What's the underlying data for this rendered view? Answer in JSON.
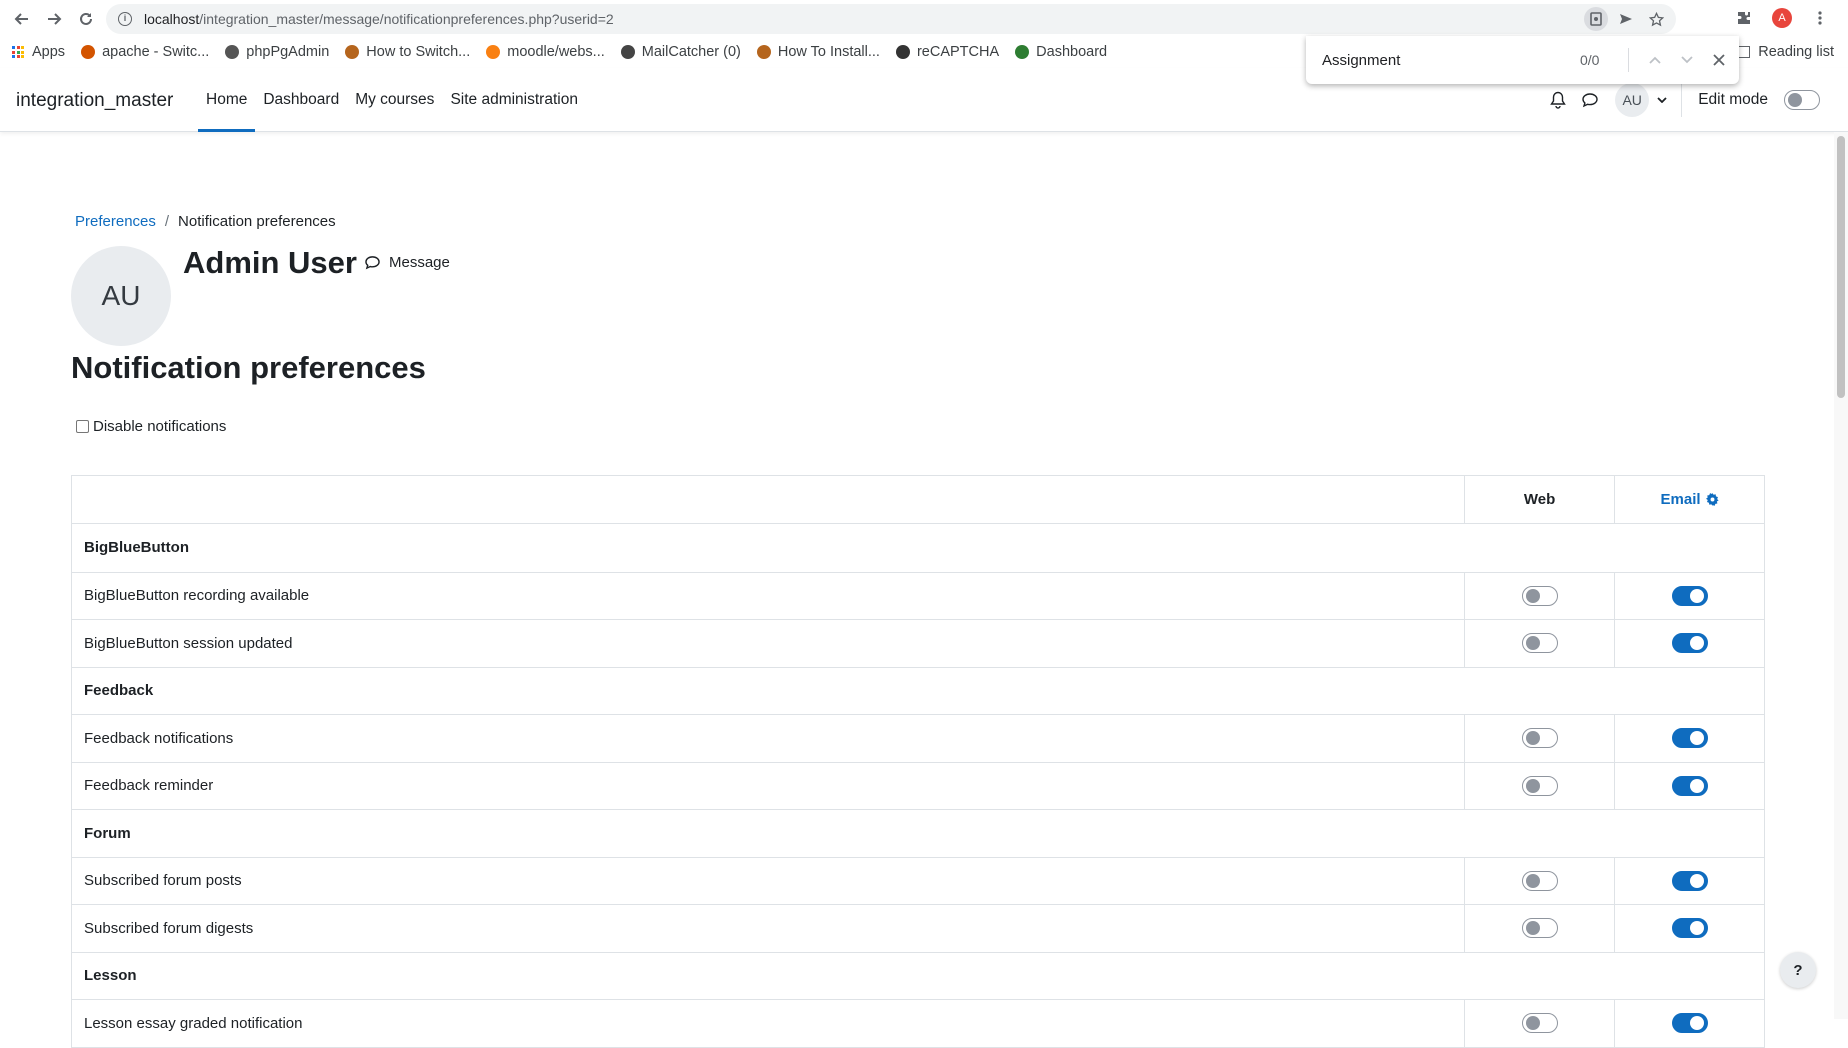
{
  "browser": {
    "url_host": "localhost",
    "url_path": "/integration_master/message/notificationpreferences.php?userid=2",
    "profile_initial": "A",
    "bookmarks": [
      {
        "label": "Apps",
        "icon": "apps-grid-icon",
        "color": "#1a73e8"
      },
      {
        "label": "apache - Switc...",
        "icon": "bookmark-favicon",
        "color": "#d35400"
      },
      {
        "label": "phpPgAdmin",
        "icon": "bookmark-favicon",
        "color": "#555555"
      },
      {
        "label": "How to Switch...",
        "icon": "bookmark-favicon",
        "color": "#b5651d"
      },
      {
        "label": "moodle/webs...",
        "icon": "bookmark-favicon",
        "color": "#f98012"
      },
      {
        "label": "MailCatcher (0)",
        "icon": "bookmark-favicon",
        "color": "#444444"
      },
      {
        "label": "How To Install...",
        "icon": "bookmark-favicon",
        "color": "#b5651d"
      },
      {
        "label": "reCAPTCHA",
        "icon": "bookmark-favicon",
        "color": "#333333"
      },
      {
        "label": "Dashboard",
        "icon": "bookmark-favicon",
        "color": "#2e7d32"
      }
    ],
    "reading_list": "Reading list",
    "find": {
      "query": "Assignment",
      "count": "0/0"
    }
  },
  "navbar": {
    "site_name": "integration_master",
    "items": [
      {
        "label": "Home",
        "active": true
      },
      {
        "label": "Dashboard",
        "active": false
      },
      {
        "label": "My courses",
        "active": false
      },
      {
        "label": "Site administration",
        "active": false
      }
    ],
    "user_initials": "AU",
    "edit_mode_label": "Edit mode"
  },
  "breadcrumb": {
    "parent": "Preferences",
    "separator": "/",
    "current": "Notification preferences"
  },
  "user": {
    "initials": "AU",
    "fullname": "Admin User",
    "message_label": "Message"
  },
  "page": {
    "heading": "Notification preferences",
    "disable_label": "Disable notifications"
  },
  "table": {
    "col_web": "Web",
    "col_email": "Email",
    "rows": [
      {
        "type": "group",
        "label": "BigBlueButton"
      },
      {
        "type": "item",
        "label": "BigBlueButton recording available",
        "web": false,
        "email": true
      },
      {
        "type": "item",
        "label": "BigBlueButton session updated",
        "web": false,
        "email": true
      },
      {
        "type": "group",
        "label": "Feedback"
      },
      {
        "type": "item",
        "label": "Feedback notifications",
        "web": false,
        "email": true
      },
      {
        "type": "item",
        "label": "Feedback reminder",
        "web": false,
        "email": true
      },
      {
        "type": "group",
        "label": "Forum"
      },
      {
        "type": "item",
        "label": "Subscribed forum posts",
        "web": false,
        "email": true
      },
      {
        "type": "item",
        "label": "Subscribed forum digests",
        "web": false,
        "email": true
      },
      {
        "type": "group",
        "label": "Lesson"
      },
      {
        "type": "item",
        "label": "Lesson essay graded notification",
        "web": false,
        "email": true
      }
    ]
  },
  "help": {
    "label": "?"
  },
  "colors": {
    "accent": "#0f6cbf",
    "text": "#1d2125",
    "border": "#dee2e6"
  }
}
